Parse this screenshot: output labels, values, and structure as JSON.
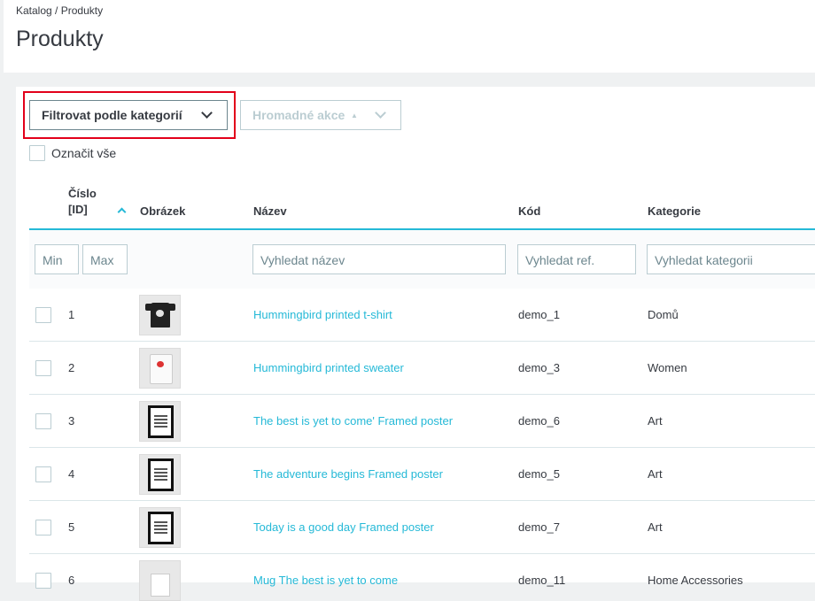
{
  "breadcrumb": {
    "items": [
      "Katalog",
      "Produkty"
    ],
    "separator": "/"
  },
  "page": {
    "title": "Produkty"
  },
  "toolbar": {
    "filter_label": "Filtrovat podle kategorií",
    "bulk_label": "Hromadné akce",
    "bulk_caret": "▲",
    "select_all_label": "Označit vše"
  },
  "table": {
    "headers": {
      "id_line1": "Číslo",
      "id_line2": "[ID]",
      "image": "Obrázek",
      "name": "Název",
      "code": "Kód",
      "category": "Kategorie"
    },
    "filters": {
      "min_placeholder": "Min",
      "max_placeholder": "Max",
      "name_placeholder": "Vyhledat název",
      "ref_placeholder": "Vyhledat ref.",
      "category_placeholder": "Vyhledat kategorii"
    },
    "rows": [
      {
        "id": "1",
        "name": "Hummingbird printed t-shirt",
        "code": "demo_1",
        "category": "Domů",
        "thumb": "tshirt"
      },
      {
        "id": "2",
        "name": "Hummingbird printed sweater",
        "code": "demo_3",
        "category": "Women",
        "thumb": "sweater"
      },
      {
        "id": "3",
        "name": "The best is yet to come' Framed poster",
        "code": "demo_6",
        "category": "Art",
        "thumb": "frame"
      },
      {
        "id": "4",
        "name": "The adventure begins Framed poster",
        "code": "demo_5",
        "category": "Art",
        "thumb": "frame"
      },
      {
        "id": "5",
        "name": "Today is a good day Framed poster",
        "code": "demo_7",
        "category": "Art",
        "thumb": "frame"
      },
      {
        "id": "6",
        "name": "Mug The best is yet to come",
        "code": "demo_11",
        "category": "Home Accessories",
        "thumb": "mug"
      }
    ]
  },
  "colors": {
    "accent": "#25b9d7",
    "highlight": "#e2001a",
    "text": "#363a41",
    "border": "#bbcdd2"
  }
}
